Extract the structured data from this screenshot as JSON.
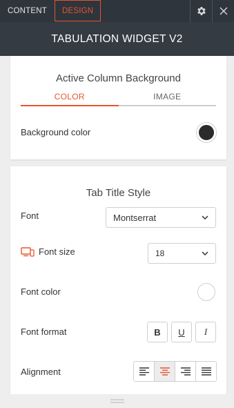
{
  "topbar": {
    "tabs": [
      {
        "label": "CONTENT",
        "active": false
      },
      {
        "label": "DESIGN",
        "active": true
      }
    ],
    "settings_icon": "gear-icon",
    "close_icon": "close-icon"
  },
  "title": "TABULATION WIDGET V2",
  "active_column_background": {
    "title": "Active Column Background",
    "subtabs": [
      {
        "label": "COLOR",
        "active": true
      },
      {
        "label": "IMAGE",
        "active": false
      }
    ],
    "background_color_label": "Background color",
    "background_color_value": "#2b2b2b"
  },
  "tab_title_style": {
    "title": "Tab Title Style",
    "font_label": "Font",
    "font_value": "Montserrat",
    "font_size_label": "Font size",
    "font_size_value": "18",
    "device_icon": "desktop-mobile-icon",
    "font_color_label": "Font color",
    "font_color_value": "#ffffff",
    "font_format_label": "Font format",
    "font_format_buttons": [
      "B",
      "U",
      "I"
    ],
    "alignment_label": "Alignment",
    "alignment_options": [
      "left",
      "center",
      "right",
      "justify"
    ],
    "alignment_selected": "center"
  },
  "colors": {
    "accent": "#e8542c",
    "topbar_bg": "#2e353d",
    "titlebar_bg": "#343b42"
  }
}
